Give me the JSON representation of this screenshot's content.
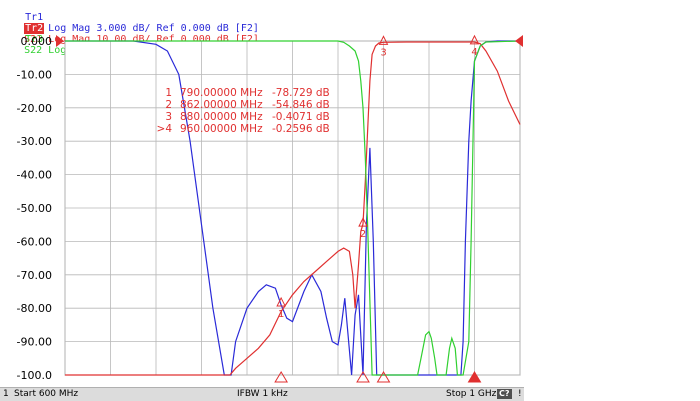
{
  "traces": [
    {
      "tag": "Tr1",
      "label": "S11 Log Mag 3.000 dB/ Ref 0.000 dB [F2]",
      "color": "#2a2ad8"
    },
    {
      "tag": "Tr2",
      "label": "S21 Log Mag 10.00 dB/ Ref 0.000 dB [F2]",
      "color": "#e03030"
    },
    {
      "tag": "Tr3",
      "label": "S22 Log Mag 3.000 dB/ Ref 0.000 dB [F2]",
      "color": "#30d030"
    }
  ],
  "y_axis_labels": [
    "0.000",
    "-10.00",
    "-20.00",
    "-30.00",
    "-40.00",
    "-50.00",
    "-60.00",
    "-70.00",
    "-80.00",
    "-90.00",
    "-100.0"
  ],
  "marker_table": [
    {
      "id": "1",
      "freq": "790.00000 MHz",
      "value": "-78.729 dB"
    },
    {
      "id": "2",
      "freq": "862.00000 MHz",
      "value": "-54.846 dB"
    },
    {
      "id": "3",
      "freq": "880.00000 MHz",
      "value": "-0.4071 dB"
    },
    {
      "id": ">4",
      "freq": "960.00000 MHz",
      "value": "-0.2596 dB"
    }
  ],
  "chart_data": {
    "type": "line",
    "xlim": [
      600,
      1000
    ],
    "ylim": [
      -100,
      0
    ],
    "x_unit": "MHz",
    "y_unit": "dB",
    "series": [
      {
        "color": "#2a2ad8",
        "x": [
          600,
          660,
          680,
          690,
          700,
          710,
          720,
          730,
          740,
          746,
          750,
          760,
          770,
          777,
          785,
          790,
          795,
          800,
          810,
          817,
          825,
          830,
          835,
          840,
          843,
          846,
          852,
          855,
          858,
          862,
          865,
          868,
          871,
          874,
          876,
          877,
          880,
          900,
          942,
          948,
          950,
          952,
          955,
          957,
          960,
          965,
          970,
          980,
          1000
        ],
        "y": [
          0,
          0,
          -1,
          -3,
          -10,
          -30,
          -55,
          -80,
          -100,
          -100,
          -90,
          -80,
          -75,
          -73,
          -74,
          -79,
          -83,
          -84,
          -75,
          -70,
          -75,
          -83,
          -90,
          -91,
          -85,
          -77,
          -100,
          -82,
          -76,
          -100,
          -55,
          -32,
          -60,
          -100,
          -100,
          -100,
          -100,
          -100,
          -100,
          -100,
          -90,
          -60,
          -30,
          -18,
          -6,
          -1.5,
          -0.3,
          0,
          0
        ]
      },
      {
        "color": "#e03030",
        "x": [
          600,
          640,
          650,
          660,
          670,
          680,
          690,
          700,
          710,
          720,
          730,
          740,
          745,
          750,
          760,
          770,
          780,
          790,
          800,
          810,
          820,
          830,
          840,
          845,
          850,
          853,
          855,
          858,
          860,
          862,
          864,
          866,
          868,
          870,
          873,
          876,
          880,
          900,
          940,
          950,
          955,
          960,
          965,
          970,
          980,
          990,
          1000
        ],
        "y": [
          -100,
          -100,
          -100,
          -100,
          -100,
          -100,
          -100,
          -100,
          -100,
          -100,
          -100,
          -100,
          -100,
          -98,
          -95,
          -92,
          -88,
          -81,
          -76,
          -72,
          -69,
          -66,
          -63,
          -62,
          -63,
          -70,
          -80,
          -67,
          -57,
          -54.8,
          -42,
          -27,
          -12,
          -4,
          -1.5,
          -0.6,
          -0.4,
          -0.3,
          -0.3,
          -0.3,
          -0.3,
          -0.3,
          -0.8,
          -3,
          -9,
          -18,
          -25
        ]
      },
      {
        "color": "#30d030",
        "x": [
          600,
          840,
          845,
          850,
          855,
          858,
          860,
          862,
          864,
          866,
          868,
          870,
          872,
          874,
          875,
          877,
          880,
          900,
          910,
          913,
          917,
          920,
          922,
          925,
          927,
          928,
          930,
          935,
          938,
          940,
          943,
          945,
          950,
          955,
          957,
          960,
          965,
          970,
          1000
        ],
        "y": [
          0,
          0,
          -0.4,
          -1.5,
          -3,
          -6,
          -12,
          -20,
          -35,
          -55,
          -78,
          -100,
          -100,
          -100,
          -100,
          -100,
          -100,
          -100,
          -100,
          -95,
          -88,
          -87,
          -89,
          -95,
          -100,
          -100,
          -100,
          -100,
          -92,
          -89,
          -92,
          -100,
          -100,
          -90,
          -60,
          -6,
          -1.5,
          -0.3,
          0
        ]
      }
    ],
    "markers": [
      {
        "label": "1",
        "x": 790,
        "y": -78.729
      },
      {
        "label": "2",
        "x": 862,
        "y": -54.846
      },
      {
        "label": "3",
        "x": 880,
        "y": -0.4071
      },
      {
        "label": "4",
        "x": 960,
        "y": -0.2596
      }
    ]
  },
  "status": {
    "channel": "1",
    "start": "Start 600 MHz",
    "ifbw": "IFBW 1 kHz",
    "stop": "Stop 1 GHz",
    "badge": "C?",
    "separator": "!"
  }
}
